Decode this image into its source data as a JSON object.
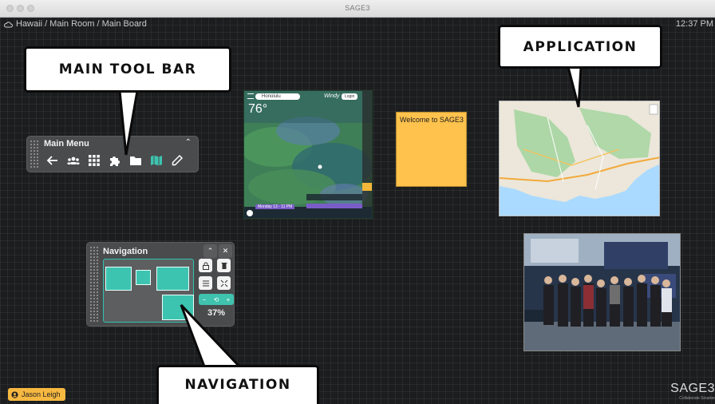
{
  "window": {
    "title": "SAGE3"
  },
  "board": {
    "breadcrumb": "Hawaii / Main Room / Main Board",
    "clock": "12:37 PM"
  },
  "callouts": {
    "main_toolbar": "MAIN TOOL BAR",
    "application": "APPLICATION",
    "navigation": "NAVIGATION"
  },
  "main_menu": {
    "title": "Main Menu",
    "collapse_icon": "chevron-up-icon",
    "tools": [
      "arrow-left-icon",
      "users-icon",
      "apps-grid-icon",
      "plugin-icon",
      "folder-icon",
      "map-icon",
      "pencil-icon"
    ]
  },
  "navigation": {
    "title": "Navigation",
    "zoom_percent": "37%",
    "zoom_controls": [
      "−",
      "⟲",
      "+"
    ]
  },
  "apps": {
    "weather": {
      "search_value": "Honolulu",
      "brand": "Windy",
      "login_label": "Login",
      "temperature": "76°",
      "timeline_label": "Monday 13 - 11 PM"
    },
    "sticky_note": {
      "text": "Welcome to SAGE3"
    }
  },
  "user": {
    "name": "Jason Leigh"
  },
  "logo": {
    "text": "SAGE3",
    "subtitle": "Collaborate Smarter"
  },
  "colors": {
    "accent": "#3dc4b0",
    "sticky": "#fec24d",
    "board": "#1c1d1f",
    "user_badge": "#f6b840"
  }
}
